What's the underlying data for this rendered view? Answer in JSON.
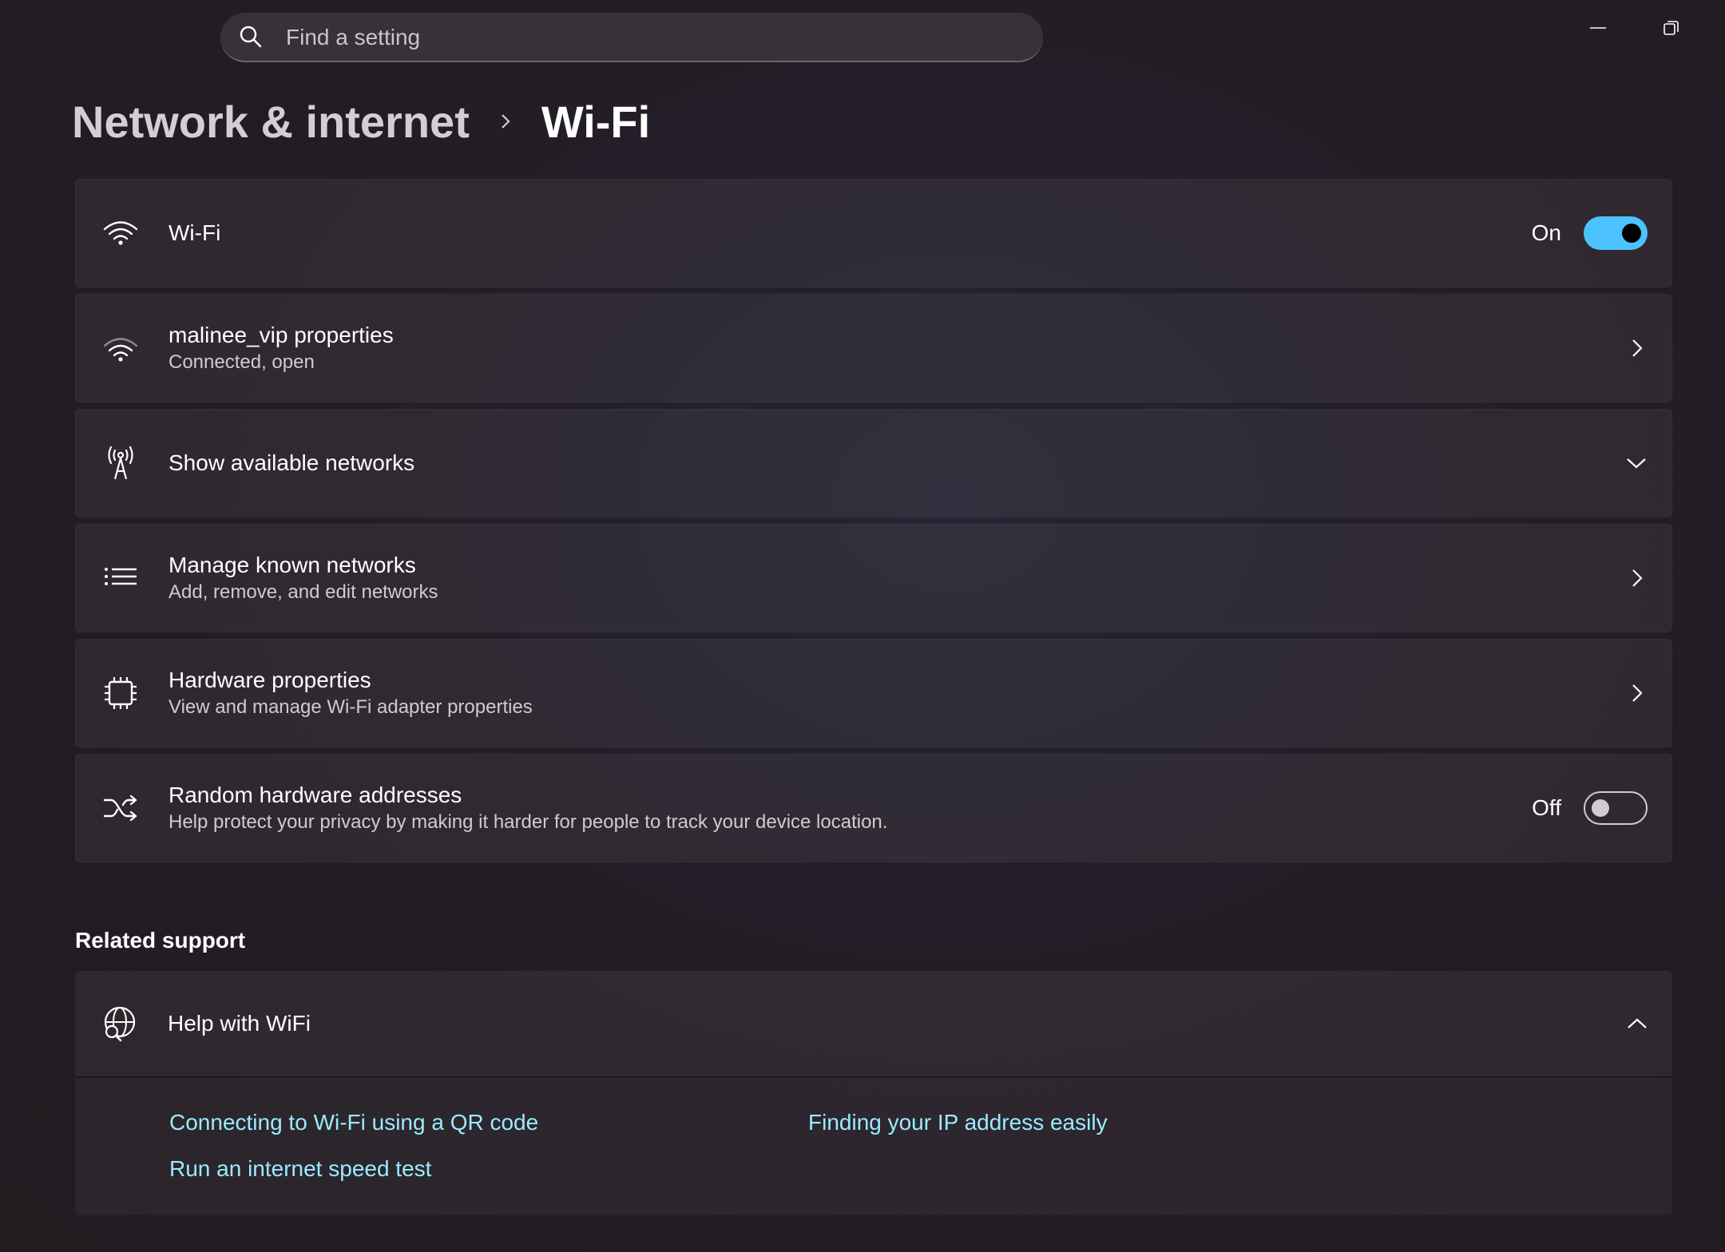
{
  "search": {
    "placeholder": "Find a setting",
    "icon": "search-icon"
  },
  "window_controls": {
    "minimize_icon": "minimize-icon",
    "restore_icon": "restore-icon"
  },
  "breadcrumb": {
    "parent": "Network & internet",
    "current": "Wi-Fi"
  },
  "settings": {
    "wifi": {
      "title": "Wi-Fi",
      "state_label": "On",
      "enabled": true,
      "icon": "wifi-icon"
    },
    "network_properties": {
      "title": "malinee_vip properties",
      "subtitle": "Connected, open",
      "icon": "wifi-connected-icon"
    },
    "available_networks": {
      "title": "Show available networks",
      "icon": "antenna-icon"
    },
    "known_networks": {
      "title": "Manage known networks",
      "subtitle": "Add, remove, and edit networks",
      "icon": "list-icon"
    },
    "hardware_properties": {
      "title": "Hardware properties",
      "subtitle": "View and manage Wi-Fi adapter properties",
      "icon": "chip-icon"
    },
    "random_addresses": {
      "title": "Random hardware addresses",
      "subtitle": "Help protect your privacy by making it harder for people to track your device location.",
      "state_label": "Off",
      "enabled": false,
      "icon": "shuffle-icon"
    }
  },
  "related_support": {
    "title": "Related support",
    "help": {
      "title": "Help with WiFi",
      "icon": "globe-search-icon",
      "links": [
        "Connecting to Wi-Fi using a QR code",
        "Finding your IP address easily",
        "Run an internet speed test"
      ]
    }
  },
  "colors": {
    "accent": "#4cc2ff",
    "link": "#99ebff"
  }
}
